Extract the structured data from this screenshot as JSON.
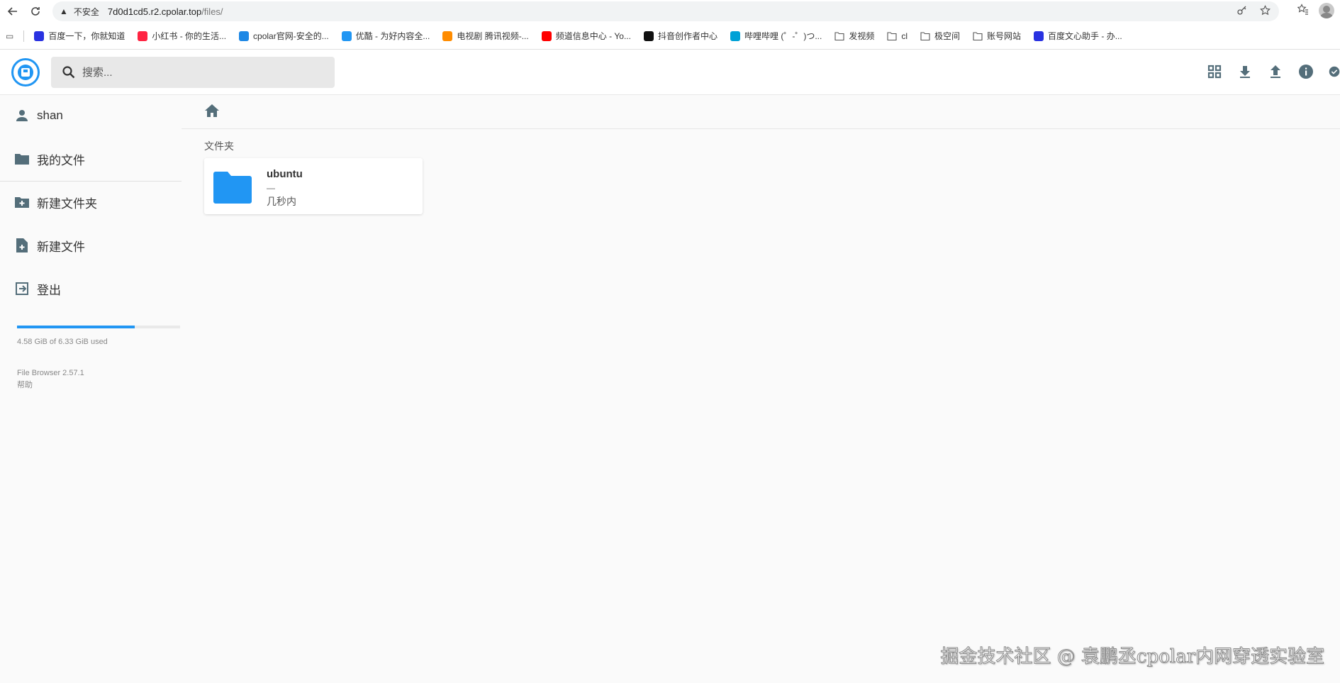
{
  "browser": {
    "back_icon": "arrow-left-icon",
    "reload_icon": "reload-icon",
    "security_label": "不安全",
    "url_host": "7d0d1cd5.r2.cpolar.top",
    "url_path": "/files/",
    "bookmarks": [
      {
        "label": "百度一下，你就知道",
        "icon": "baidu-icon",
        "color": "#2932e1"
      },
      {
        "label": "小红书 - 你的生活...",
        "icon": "xiaohongshu-icon",
        "color": "#ff2442"
      },
      {
        "label": "cpolar官网-安全的...",
        "icon": "cpolar-icon",
        "color": "#1e88e5"
      },
      {
        "label": "优酷 - 为好内容全...",
        "icon": "youku-icon",
        "color": "#2196f3"
      },
      {
        "label": "电视剧 腾讯视频-...",
        "icon": "tencent-video-icon",
        "color": "#ff8c00"
      },
      {
        "label": "频道信息中心 - Yo...",
        "icon": "youtube-icon",
        "color": "#ff0000"
      },
      {
        "label": "抖音创作者中心",
        "icon": "douyin-icon",
        "color": "#111111"
      },
      {
        "label": "哔哩哔哩 (゜-゜)つ...",
        "icon": "bilibili-icon",
        "color": "#00a1d6"
      },
      {
        "label": "发视频",
        "icon": "folder-icon",
        "color": "#555555"
      },
      {
        "label": "cl",
        "icon": "folder-icon",
        "color": "#555555"
      },
      {
        "label": "极空间",
        "icon": "folder-icon",
        "color": "#555555"
      },
      {
        "label": "账号网站",
        "icon": "folder-icon",
        "color": "#555555"
      },
      {
        "label": "百度文心助手 - 办...",
        "icon": "baidu-icon",
        "color": "#2932e1"
      }
    ]
  },
  "header": {
    "search_placeholder": "搜索...",
    "actions": [
      "view-mode-icon",
      "download-icon",
      "upload-icon",
      "info-icon",
      "select-check-icon"
    ]
  },
  "sidebar": {
    "user": "shan",
    "my_files": "我的文件",
    "new_folder": "新建文件夹",
    "new_file": "新建文件",
    "logout": "登出",
    "quota_fraction": 0.723,
    "quota_text": "4.58 GiB of 6.33 GiB used",
    "version": "File Browser 2.57.1",
    "help": "帮助"
  },
  "main": {
    "section_title": "文件夹",
    "folders": [
      {
        "name": "ubuntu",
        "size": "—",
        "modified": "几秒内"
      }
    ]
  },
  "watermark": "掘金技术社区 @ 袁鹏丞cpolar内网穿透实验室",
  "colors": {
    "accent": "#2196f3",
    "icon_dark": "#546e7a"
  }
}
